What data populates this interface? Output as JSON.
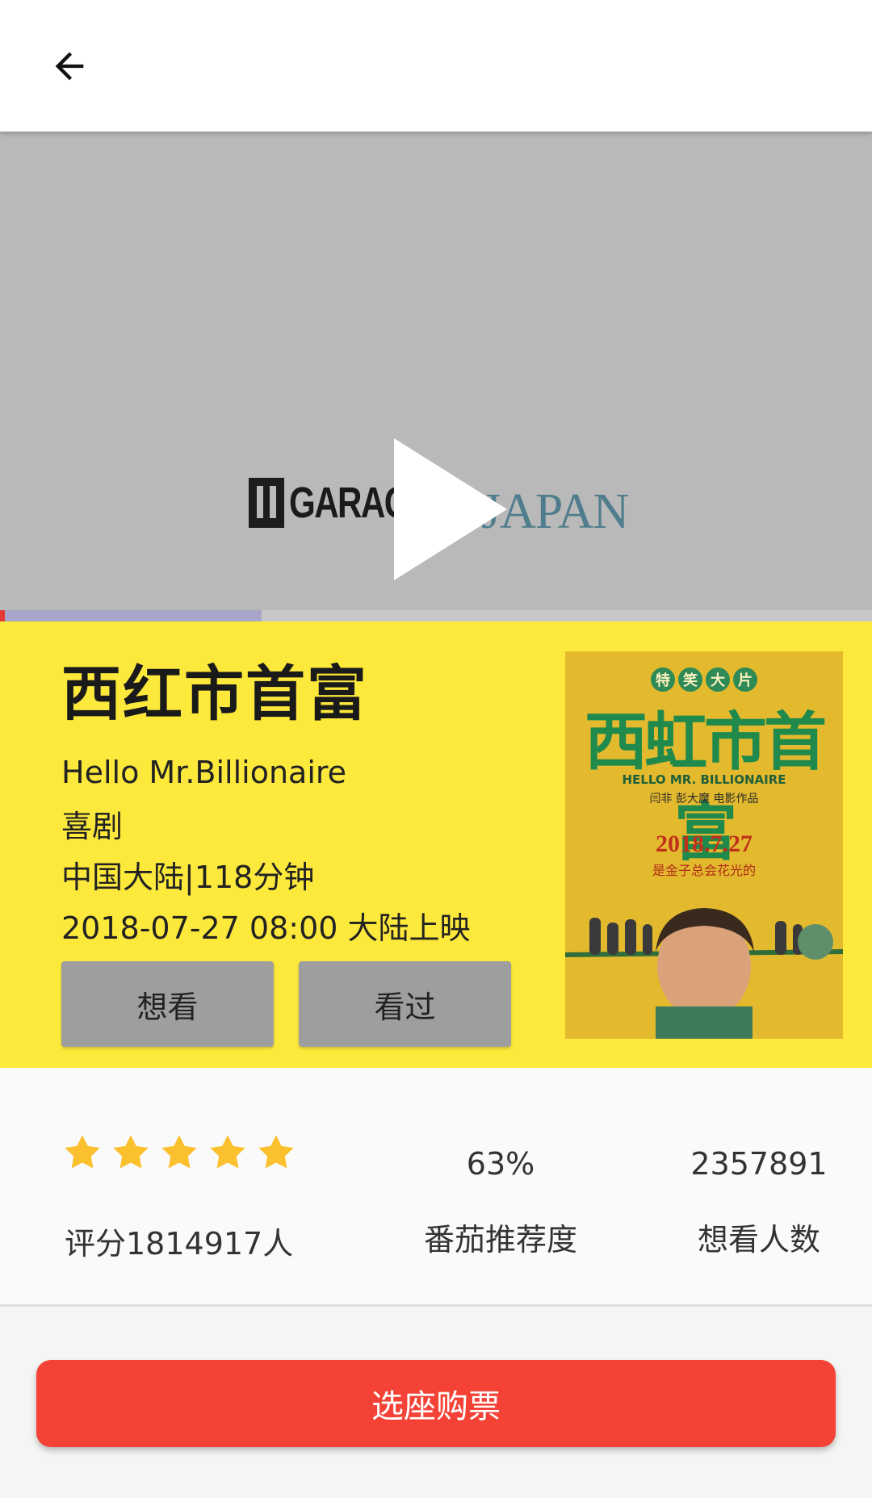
{
  "video": {
    "watermark_left": "GARAGE",
    "watermark_right": "JAPAN",
    "progress": {
      "buffered_fraction": 0.3,
      "played_fraction": 0.006
    }
  },
  "movie": {
    "title": "西红市首富",
    "english_title": "Hello Mr.Billionaire",
    "genre": "喜剧",
    "region_duration": "中国大陆|118分钟",
    "release": "2018-07-27 08:00 大陆上映",
    "want_label": "想看",
    "seen_label": "看过"
  },
  "poster": {
    "subtitle_chars": [
      "特",
      "笑",
      "大",
      "片"
    ],
    "title": "西虹市首富",
    "english": "HELLO MR. BILLIONAIRE",
    "credit": "闫非  彭大魔  电影作品",
    "date": "2018.7.27",
    "tagline": "是金子总会花光的"
  },
  "stats": {
    "stars": 5,
    "rating_count_text": "评分1814917人",
    "recommend_pct": "63%",
    "recommend_label": "番茄推荐度",
    "want_count": "2357891",
    "want_count_label": "想看人数"
  },
  "colors": {
    "accent_red": "#f44336",
    "info_yellow": "#fde93c",
    "star": "#fbc02d",
    "action_gray": "#9e9e9e"
  },
  "buy_label": "选座购票"
}
